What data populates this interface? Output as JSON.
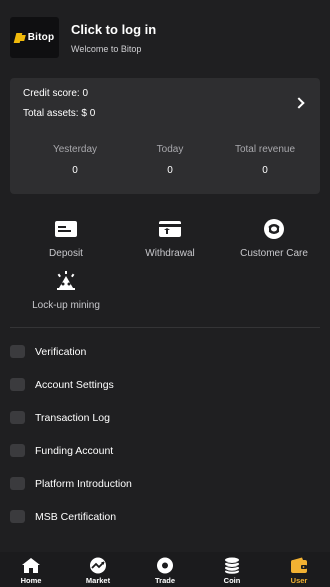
{
  "header": {
    "logo_text": "Bitop",
    "login_title": "Click to log in",
    "login_subtitle": "Welcome to Bitop"
  },
  "account_card": {
    "credit_score": "Credit score: 0",
    "total_assets": "Total assets: $ 0",
    "stats": [
      {
        "label": "Yesterday",
        "value": "0"
      },
      {
        "label": "Today",
        "value": "0"
      },
      {
        "label": "Total revenue",
        "value": "0"
      }
    ]
  },
  "quick_menu": [
    {
      "label": "Deposit",
      "icon": "deposit-card-icon"
    },
    {
      "label": "Withdrawal",
      "icon": "withdrawal-card-icon"
    },
    {
      "label": "Customer Care",
      "icon": "headset-icon"
    },
    {
      "label": "Lock-up mining",
      "icon": "mining-icon"
    }
  ],
  "settings_list": [
    {
      "label": "Verification"
    },
    {
      "label": "Account Settings"
    },
    {
      "label": "Transaction Log"
    },
    {
      "label": "Funding Account"
    },
    {
      "label": "Platform Introduction"
    },
    {
      "label": "MSB Certification"
    }
  ],
  "tabbar": {
    "active": "User",
    "active_color": "#f2b132",
    "tabs": [
      {
        "label": "Home",
        "icon": "home-icon"
      },
      {
        "label": "Market",
        "icon": "market-trend-icon"
      },
      {
        "label": "Trade",
        "icon": "trade-icon"
      },
      {
        "label": "Coin",
        "icon": "coin-stack-icon"
      },
      {
        "label": "User",
        "icon": "wallet-icon"
      }
    ]
  },
  "colors": {
    "background": "#1f1f21",
    "card": "#2e2e30",
    "accent": "#f0b90b"
  }
}
